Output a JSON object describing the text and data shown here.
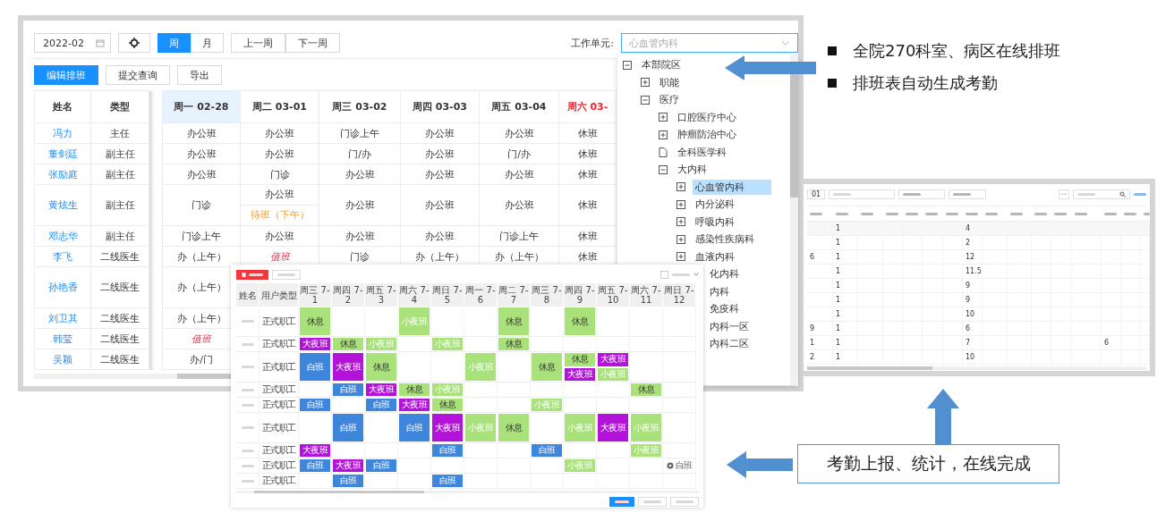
{
  "slide": {
    "bullets": [
      "全院270科室、病区在线排班",
      "排班表自动生成考勤"
    ],
    "callout": "考勤上报、统计，在线完成"
  },
  "schedule_window": {
    "month": "2022-02",
    "view_tabs": [
      {
        "label": "周",
        "selected": true
      },
      {
        "label": "月",
        "selected": false
      }
    ],
    "nav_buttons": [
      "上一周",
      "下一周"
    ],
    "unit_label": "工作单元:",
    "unit_value": "心血管内科",
    "actions": [
      {
        "label": "编辑排班",
        "kind": "primary"
      },
      {
        "label": "提交查询",
        "kind": "plain"
      },
      {
        "label": "导出",
        "kind": "plain"
      }
    ],
    "columns": [
      "姓名",
      "类型"
    ],
    "days": [
      {
        "label": "周一 02-28",
        "selected": true,
        "weekend": false
      },
      {
        "label": "周二 03-01",
        "selected": false,
        "weekend": false
      },
      {
        "label": "周三 03-02",
        "selected": false,
        "weekend": false
      },
      {
        "label": "周四 03-03",
        "selected": false,
        "weekend": false
      },
      {
        "label": "周五 03-04",
        "selected": false,
        "weekend": false
      },
      {
        "label": "周六 03-",
        "selected": false,
        "weekend": true
      }
    ],
    "rows": [
      {
        "name": "冯力",
        "type": "主任",
        "tall": false,
        "cells": [
          [
            {
              "text": "办公班",
              "kind": "plain"
            }
          ],
          [
            {
              "text": "办公班",
              "kind": "plain"
            }
          ],
          [
            {
              "text": "门诊上午",
              "kind": "plain"
            }
          ],
          [
            {
              "text": "办公班",
              "kind": "plain"
            }
          ],
          [
            {
              "text": "办公班",
              "kind": "plain"
            }
          ],
          [
            {
              "text": "休班",
              "kind": "plain"
            }
          ]
        ]
      },
      {
        "name": "董剑廷",
        "type": "副主任",
        "tall": false,
        "cells": [
          [
            {
              "text": "办公班",
              "kind": "plain"
            }
          ],
          [
            {
              "text": "办公班",
              "kind": "plain"
            }
          ],
          [
            {
              "text": "门/办",
              "kind": "plain"
            }
          ],
          [
            {
              "text": "办公班",
              "kind": "plain"
            }
          ],
          [
            {
              "text": "门/办",
              "kind": "plain"
            }
          ],
          [
            {
              "text": "休班",
              "kind": "plain"
            }
          ]
        ]
      },
      {
        "name": "张励庭",
        "type": "副主任",
        "tall": false,
        "cells": [
          [
            {
              "text": "办公班",
              "kind": "plain"
            }
          ],
          [
            {
              "text": "门诊",
              "kind": "plain"
            }
          ],
          [
            {
              "text": "办公班",
              "kind": "plain"
            }
          ],
          [
            {
              "text": "办公班",
              "kind": "plain"
            }
          ],
          [
            {
              "text": "办公班",
              "kind": "plain"
            }
          ],
          [
            {
              "text": "休班",
              "kind": "plain"
            }
          ]
        ]
      },
      {
        "name": "黄炫生",
        "type": "副主任",
        "tall": true,
        "cells": [
          [
            {
              "text": "门诊",
              "kind": "plain"
            }
          ],
          [
            {
              "text": "办公班",
              "kind": "plain"
            },
            {
              "text": "待班（下午）",
              "kind": "standby"
            }
          ],
          [
            {
              "text": "办公班",
              "kind": "plain"
            }
          ],
          [
            {
              "text": "办公班",
              "kind": "plain"
            }
          ],
          [
            {
              "text": "办公班",
              "kind": "plain"
            }
          ],
          [
            {
              "text": "休班",
              "kind": "plain"
            }
          ]
        ]
      },
      {
        "name": "邓志华",
        "type": "副主任",
        "tall": false,
        "cells": [
          [
            {
              "text": "门诊上午",
              "kind": "plain"
            }
          ],
          [
            {
              "text": "办公班",
              "kind": "plain"
            }
          ],
          [
            {
              "text": "办公班",
              "kind": "plain"
            }
          ],
          [
            {
              "text": "办公班",
              "kind": "plain"
            }
          ],
          [
            {
              "text": "门诊上午",
              "kind": "plain"
            }
          ],
          [
            {
              "text": "休班",
              "kind": "plain"
            }
          ]
        ]
      },
      {
        "name": "李飞",
        "type": "二线医生",
        "tall": false,
        "cells": [
          [
            {
              "text": "办（上午）",
              "kind": "plain"
            }
          ],
          [
            {
              "text": "值班",
              "kind": "duty"
            }
          ],
          [
            {
              "text": "门诊",
              "kind": "plain"
            }
          ],
          [
            {
              "text": "办（上午）",
              "kind": "plain"
            }
          ],
          [
            {
              "text": "办（上午）",
              "kind": "plain"
            }
          ],
          [
            {
              "text": "休班",
              "kind": "plain"
            }
          ]
        ]
      },
      {
        "name": "孙艳香",
        "type": "二线医生",
        "tall": true,
        "cells": [
          [
            {
              "text": "办（上午）",
              "kind": "plain"
            }
          ]
        ]
      },
      {
        "name": "刘卫其",
        "type": "二线医生",
        "tall": false,
        "cells": [
          [
            {
              "text": "办（上午）",
              "kind": "plain"
            }
          ]
        ]
      },
      {
        "name": "韩莹",
        "type": "二线医生",
        "tall": false,
        "cells": [
          [
            {
              "text": "值班",
              "kind": "duty"
            }
          ]
        ]
      },
      {
        "name": "吴颖",
        "type": "二线医生",
        "tall": false,
        "cells": [
          [
            {
              "text": "办/门",
              "kind": "plain"
            }
          ]
        ]
      }
    ],
    "unit_tree": [
      {
        "label": "本部院区",
        "kind": "group",
        "expanded": true,
        "selected": false,
        "children": [
          {
            "label": "职能",
            "kind": "group",
            "expanded": false,
            "selected": false
          },
          {
            "label": "医疗",
            "kind": "group",
            "expanded": true,
            "selected": false,
            "children": [
              {
                "label": "口腔医疗中心",
                "kind": "group",
                "expanded": false,
                "selected": false
              },
              {
                "label": "肿瘤防治中心",
                "kind": "group",
                "expanded": false,
                "selected": false
              },
              {
                "label": "全科医学科",
                "kind": "leaf",
                "selected": false
              },
              {
                "label": "大内科",
                "kind": "group",
                "expanded": true,
                "selected": false,
                "children": [
                  {
                    "label": "心血管内科",
                    "kind": "group",
                    "expanded": false,
                    "selected": true
                  },
                  {
                    "label": "内分泌科",
                    "kind": "group",
                    "expanded": false,
                    "selected": false
                  },
                  {
                    "label": "呼吸内科",
                    "kind": "group",
                    "expanded": false,
                    "selected": false
                  },
                  {
                    "label": "感染性疾病科",
                    "kind": "group",
                    "expanded": false,
                    "selected": false
                  },
                  {
                    "label": "血液内科",
                    "kind": "group",
                    "expanded": false,
                    "selected": false
                  },
                  {
                    "label": "化内科",
                    "kind": "partial",
                    "selected": false
                  },
                  {
                    "label": "内科",
                    "kind": "partial",
                    "selected": false
                  },
                  {
                    "label": "免疫科",
                    "kind": "partial",
                    "selected": false
                  },
                  {
                    "label": "内科一区",
                    "kind": "partial",
                    "selected": false
                  },
                  {
                    "label": "内科二区",
                    "kind": "partial",
                    "selected": false
                  }
                ]
              }
            ]
          }
        ]
      }
    ]
  },
  "shift_editor": {
    "option_checkbox": {
      "checked": false
    },
    "columns": [
      "姓名",
      "用户类型"
    ],
    "days": [
      "周三 7-1",
      "周四 7-2",
      "周五 7-3",
      "周六 7-4",
      "周日 7-5",
      "周一 7-6",
      "周二 7-7",
      "周三 7-8",
      "周四 7-9",
      "周五 7-10",
      "周六 7-11",
      "周日 7-12"
    ],
    "rows": [
      {
        "type": "正式职工",
        "tall": true,
        "cells": [
          [
            {
              "text": "休息",
              "kind": "rest"
            }
          ],
          [],
          [],
          [
            {
              "text": "小夜班",
              "kind": "evening"
            }
          ],
          [],
          [],
          [
            {
              "text": "休息",
              "kind": "rest"
            }
          ],
          [],
          [
            {
              "text": "休息",
              "kind": "rest"
            }
          ],
          [],
          [],
          []
        ]
      },
      {
        "type": "正式职工",
        "tall": false,
        "cells": [
          [
            {
              "text": "大夜班",
              "kind": "night"
            }
          ],
          [
            {
              "text": "休息",
              "kind": "rest"
            }
          ],
          [
            {
              "text": "小夜班",
              "kind": "evening"
            }
          ],
          [],
          [
            {
              "text": "小夜班",
              "kind": "evening"
            }
          ],
          [],
          [
            {
              "text": "休息",
              "kind": "rest"
            }
          ],
          [],
          [],
          [],
          [],
          []
        ]
      },
      {
        "type": "正式职工",
        "tall": true,
        "cells": [
          [
            {
              "text": "白班",
              "kind": "day"
            }
          ],
          [
            {
              "text": "大夜班",
              "kind": "night"
            }
          ],
          [
            {
              "text": "休息",
              "kind": "rest"
            }
          ],
          [],
          [],
          [
            {
              "text": "小夜班",
              "kind": "evening"
            }
          ],
          [],
          [
            {
              "text": "休息",
              "kind": "rest"
            }
          ],
          [
            {
              "text": "休息",
              "kind": "rest"
            },
            {
              "text": "大夜班",
              "kind": "night"
            }
          ],
          [
            {
              "text": "大夜班",
              "kind": "night"
            },
            {
              "text": "小夜班",
              "kind": "evening"
            }
          ],
          [],
          []
        ]
      },
      {
        "type": "正式职工",
        "tall": false,
        "cells": [
          [],
          [
            {
              "text": "白班",
              "kind": "day"
            }
          ],
          [
            {
              "text": "大夜班",
              "kind": "night"
            }
          ],
          [
            {
              "text": "休息",
              "kind": "rest"
            }
          ],
          [
            {
              "text": "小夜班",
              "kind": "evening"
            }
          ],
          [],
          [],
          [],
          [],
          [],
          [
            {
              "text": "休息",
              "kind": "rest"
            }
          ],
          []
        ]
      },
      {
        "type": "正式职工",
        "tall": false,
        "cells": [
          [
            {
              "text": "白班",
              "kind": "day"
            }
          ],
          [],
          [
            {
              "text": "白班",
              "kind": "day"
            }
          ],
          [
            {
              "text": "大夜班",
              "kind": "night"
            }
          ],
          [
            {
              "text": "休息",
              "kind": "rest"
            }
          ],
          [],
          [],
          [
            {
              "text": "小夜班",
              "kind": "evening"
            }
          ],
          [],
          [],
          [],
          []
        ]
      },
      {
        "type": "正式职工",
        "tall": true,
        "cells": [
          [],
          [
            {
              "text": "白班",
              "kind": "day"
            }
          ],
          [],
          [
            {
              "text": "白班",
              "kind": "day"
            }
          ],
          [
            {
              "text": "大夜班",
              "kind": "night"
            }
          ],
          [
            {
              "text": "小夜班",
              "kind": "evening"
            }
          ],
          [
            {
              "text": "休息",
              "kind": "rest"
            }
          ],
          [],
          [
            {
              "text": "小夜班",
              "kind": "evening"
            }
          ],
          [
            {
              "text": "大夜班",
              "kind": "night"
            }
          ],
          [
            {
              "text": "小夜班",
              "kind": "evening"
            }
          ],
          []
        ]
      },
      {
        "type": "正式职工",
        "tall": false,
        "cells": [
          [
            {
              "text": "大夜班",
              "kind": "night"
            }
          ],
          [],
          [],
          [],
          [
            {
              "text": "白班",
              "kind": "day"
            }
          ],
          [],
          [],
          [
            {
              "text": "白班",
              "kind": "day"
            }
          ],
          [],
          [],
          [
            {
              "text": "小夜班",
              "kind": "evening"
            }
          ],
          []
        ]
      },
      {
        "type": "正式职工",
        "tall": false,
        "cells": [
          [
            {
              "text": "白班",
              "kind": "day"
            }
          ],
          [
            {
              "text": "大夜班",
              "kind": "night"
            }
          ],
          [
            {
              "text": "白班",
              "kind": "day"
            }
          ],
          [],
          [],
          [],
          [],
          [],
          [
            {
              "text": "小夜班",
              "kind": "evening"
            }
          ],
          [],
          [],
          [
            {
              "text": "白班",
              "kind": "marked"
            }
          ]
        ]
      },
      {
        "type": "正式职工",
        "tall": false,
        "cells": [
          [],
          [
            {
              "text": "白班",
              "kind": "day"
            }
          ],
          [],
          [],
          [
            {
              "text": "白班",
              "kind": "day"
            }
          ],
          [],
          [],
          [],
          [],
          [],
          [],
          []
        ]
      }
    ]
  },
  "attendance_stats": {
    "date": "01",
    "rows": [
      [
        null,
        "1",
        null,
        null,
        null,
        null,
        null,
        "4",
        null,
        null,
        null,
        null,
        null,
        null,
        null,
        null
      ],
      [
        null,
        "1",
        null,
        null,
        null,
        null,
        null,
        "2",
        null,
        null,
        null,
        null,
        null,
        null,
        null,
        null
      ],
      [
        "6",
        "1",
        null,
        null,
        null,
        null,
        null,
        "12",
        null,
        null,
        null,
        null,
        null,
        null,
        null,
        null
      ],
      [
        null,
        "1",
        null,
        null,
        null,
        null,
        null,
        "11.5",
        null,
        null,
        null,
        null,
        null,
        null,
        null,
        null
      ],
      [
        null,
        "1",
        null,
        null,
        null,
        null,
        null,
        "9",
        null,
        null,
        null,
        null,
        null,
        null,
        null,
        null
      ],
      [
        null,
        "1",
        null,
        null,
        null,
        null,
        null,
        "9",
        null,
        null,
        null,
        null,
        null,
        null,
        null,
        null
      ],
      [
        null,
        "1",
        null,
        null,
        null,
        null,
        null,
        "10",
        null,
        null,
        null,
        null,
        null,
        null,
        null,
        null
      ],
      [
        "9",
        "1",
        null,
        null,
        null,
        null,
        null,
        "6",
        null,
        null,
        null,
        null,
        null,
        null,
        null,
        null
      ],
      [
        "1",
        "1",
        null,
        null,
        null,
        null,
        null,
        "7",
        null,
        null,
        null,
        null,
        null,
        "6",
        null,
        null
      ],
      [
        "2",
        "1",
        null,
        null,
        null,
        null,
        null,
        "10",
        null,
        null,
        null,
        null,
        null,
        null,
        null,
        null
      ]
    ]
  }
}
